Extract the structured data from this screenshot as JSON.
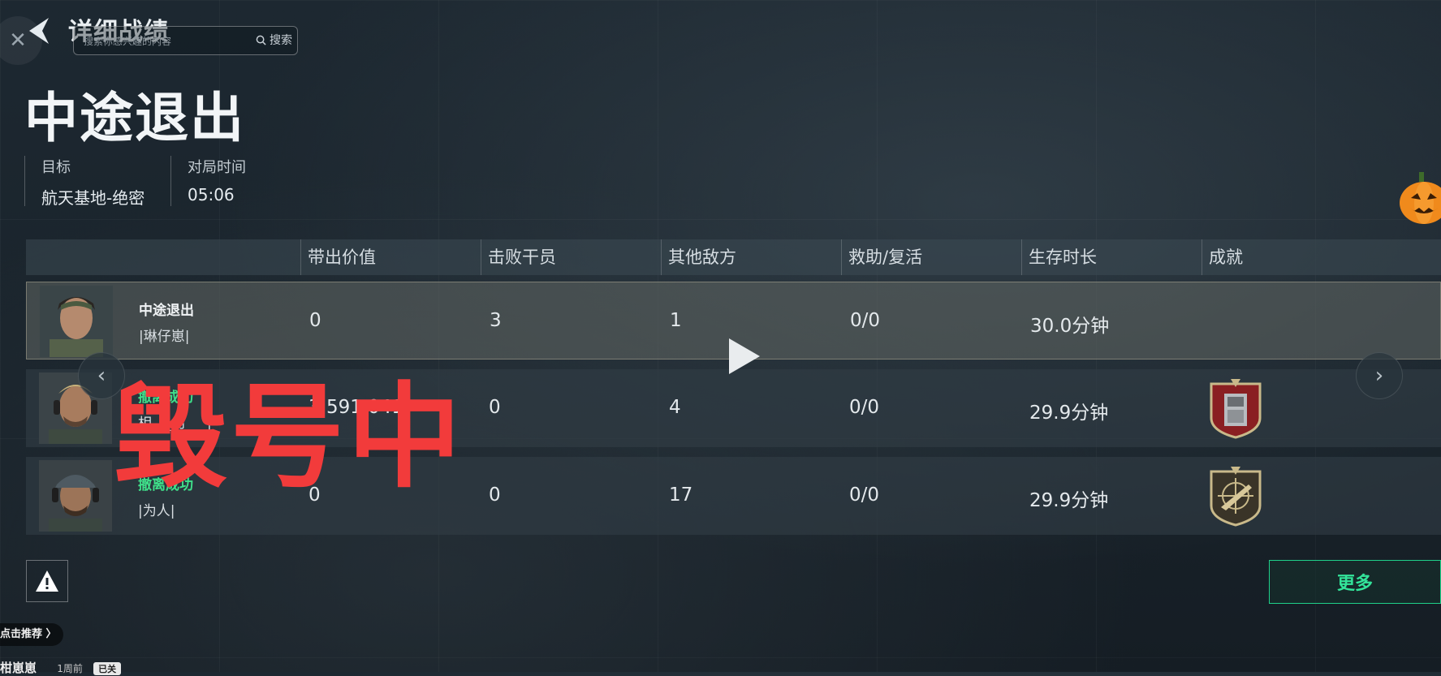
{
  "header": {
    "title": "详细战绩",
    "search": {
      "placeholder": "搜索你感兴趣的内容",
      "button_label": "搜索"
    },
    "close_icon": "close-icon",
    "back_icon": "back-arrow-icon"
  },
  "result": {
    "heading": "中途退出",
    "target_label": "目标",
    "target_value": "航天基地-绝密",
    "time_label": "对局时间",
    "time_value": "05:06"
  },
  "table": {
    "columns": [
      "带出价值",
      "击败干员",
      "其他敌方",
      "救助/复活",
      "生存时长",
      "成就"
    ],
    "rows": [
      {
        "status": "中途退出",
        "player": "|琳仔崽|",
        "value": "0",
        "kills": "3",
        "other": "1",
        "assist": "0/0",
        "survival": "30.0分钟",
        "medal": ""
      },
      {
        "status": "撤离成功",
        "player": "相___月___|",
        "value": "3,591,041",
        "kills": "0",
        "other": "4",
        "assist": "0/0",
        "survival": "29.9分钟",
        "medal": "vault-medal-icon"
      },
      {
        "status": "撤离成功",
        "player": "|为人|",
        "value": "0",
        "kills": "0",
        "other": "17",
        "assist": "0/0",
        "survival": "29.9分钟",
        "medal": "rifle-medal-icon"
      }
    ]
  },
  "overlay": {
    "watermark": "毁号中"
  },
  "footer": {
    "more_label": "更多",
    "recommend_label": "点击推荐 〉",
    "bottom_title": "柑崽崽",
    "bottom_sub": "1周前",
    "bottom_tag": "已关"
  },
  "colors": {
    "accent_green": "#33e49a",
    "watermark_red": "#f23b3b",
    "success_green": "#3fe08a"
  }
}
